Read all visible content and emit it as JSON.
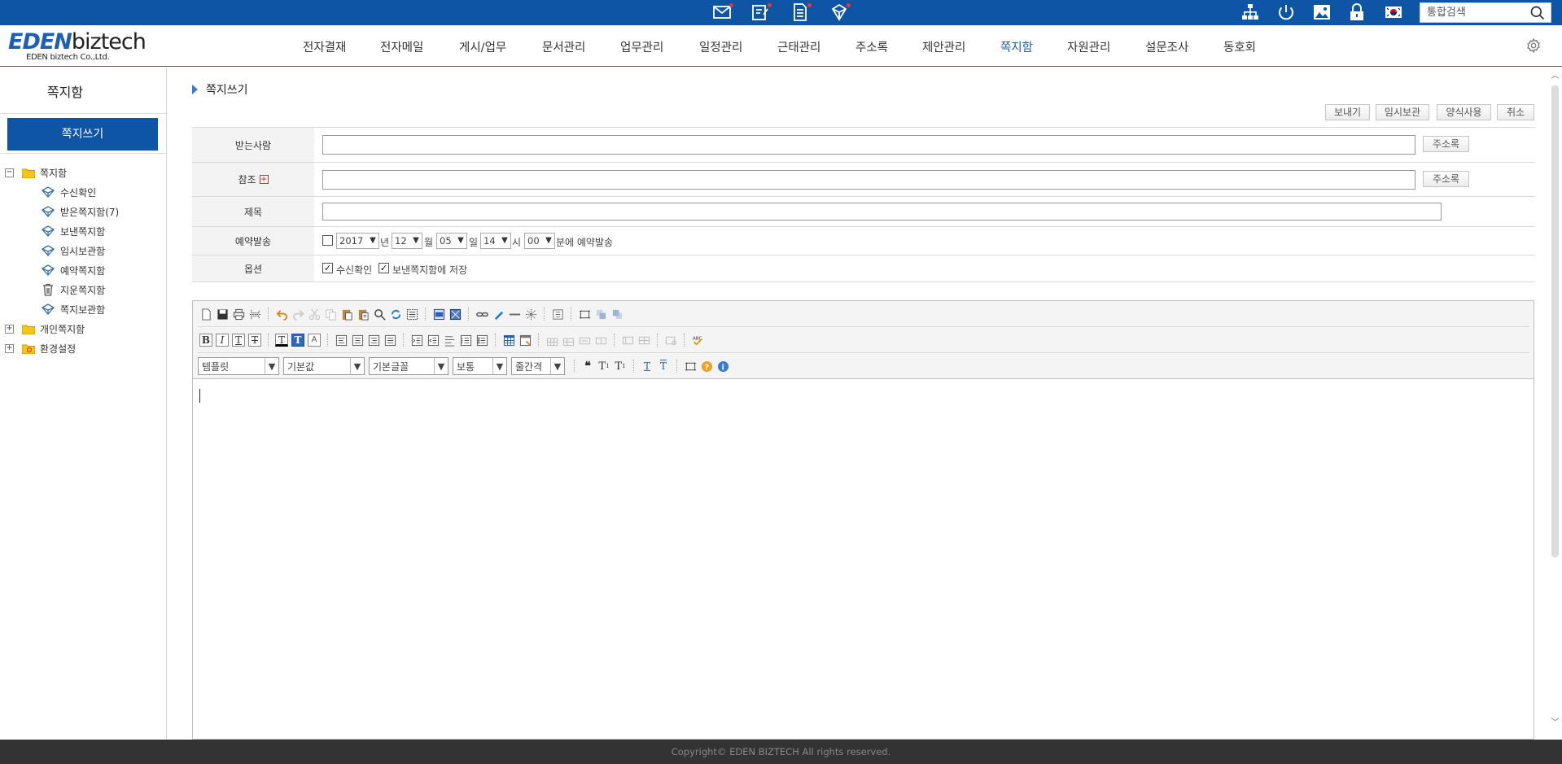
{
  "topbar": {
    "bg_color": "#0f55a6",
    "icons": [
      "mail-icon",
      "approval-icon",
      "document-icon",
      "note-icon",
      "org-chart-icon",
      "power-icon",
      "image-icon",
      "lock-icon",
      "flag-kr-icon",
      "search-icon"
    ],
    "search_placeholder": "통합검색"
  },
  "logo": {
    "brand_a": "EDEN",
    "brand_b": "biztech",
    "sub": "EDEN biztech Co.,Ltd."
  },
  "nav": {
    "items": [
      "전자결재",
      "전자메일",
      "게시/업무",
      "문서관리",
      "업무관리",
      "일정관리",
      "근태관리",
      "주소록",
      "제안관리",
      "쪽지함",
      "자원관리",
      "설문조사",
      "동호회"
    ],
    "active": "쪽지함",
    "accent_color": "#1e5fb5"
  },
  "sidebar": {
    "title": "쪽지함",
    "compose_label": "쪽지쓰기",
    "tree": {
      "root": {
        "label": "쪽지함",
        "toggle": "−"
      },
      "children": [
        "수신확인",
        "받은쪽지함(7)",
        "보낸쪽지함",
        "임시보관함",
        "예약쪽지함",
        "지운쪽지함",
        "쪽지보관함"
      ],
      "personal": {
        "label": "개인쪽지함",
        "toggle": "+"
      },
      "settings": {
        "label": "환경설정",
        "toggle": "+"
      }
    }
  },
  "main": {
    "title": "쪽지쓰기",
    "actions": {
      "send": "보내기",
      "save_draft": "임시보관",
      "use_template": "양식사용",
      "cancel": "취소"
    },
    "form": {
      "recipient_label": "받는사람",
      "cc_label": "참조",
      "subject_label": "제목",
      "schedule_label": "예약발송",
      "options_label": "옵션",
      "address_book": "주소록",
      "recipient_value": "",
      "cc_value": "",
      "subject_value": "",
      "schedule": {
        "enabled": false,
        "year": "2017",
        "year_unit": "년",
        "month": "12",
        "month_unit": "월",
        "day": "05",
        "day_unit": "일",
        "hour": "14",
        "hour_unit": "시",
        "minute": "00",
        "minute_suffix": "분에 예약발송"
      },
      "options": {
        "read_receipt": {
          "label": "수신확인",
          "checked": true
        },
        "save_sent": {
          "label": "보낸쪽지함에 저장",
          "checked": true
        }
      }
    },
    "editor": {
      "template_select": "템플릿",
      "style_select": "기본값",
      "font_select": "기본글꼴",
      "size_select": "보통",
      "line_height_select": "줄간격",
      "content": ""
    }
  },
  "footer": {
    "copyright": "Copyright© EDEN BIZTECH All rights reserved."
  }
}
